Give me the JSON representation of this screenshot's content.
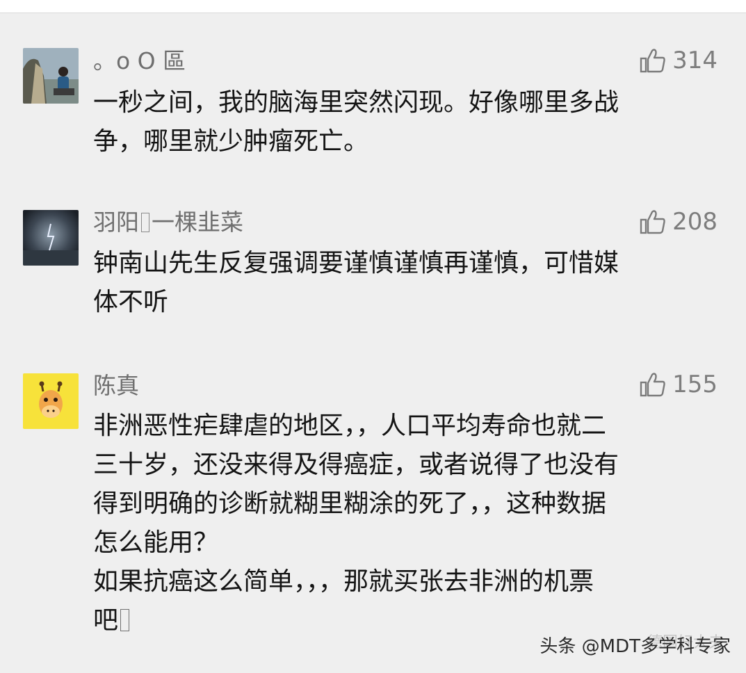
{
  "comments": [
    {
      "author": "。o O 區",
      "likes": "314",
      "lines": [
        "一秒之间，我的脑海里突然闪现。好像哪里多战",
        "争，哪里就少肿瘤死亡。"
      ]
    },
    {
      "author": "羽阳",
      "author_tail": "一棵韭菜",
      "likes": "208",
      "lines": [
        "钟南山先生反复强调要谨慎谨慎再谨慎，可惜媒",
        "体不听"
      ]
    },
    {
      "author": "陈真",
      "likes": "155",
      "lines": [
        "非洲恶性疟肆虐的地区，，人口平均寿命也就二",
        "三十岁，还没来得及得癌症，或者说得了也没有",
        "得到明确的诊断就糊里糊涂的死了，，这种数据",
        "怎么能用？",
        "如果抗癌这么简单，，，那就买张去非洲的机票",
        "吧"
      ]
    }
  ],
  "watermark": {
    "text": "头条 @MDT多学科专家",
    "faint_text": "德国好大夫"
  },
  "icons": {
    "like": "thumbs-up-outline-icon",
    "missing_glyph": "missing-glyph-box"
  },
  "colors": {
    "background": "#efefef",
    "author": "#6f6f6f",
    "body": "#141414",
    "like": "#7a7a7a",
    "giraffe_bg": "#f7e23a"
  }
}
